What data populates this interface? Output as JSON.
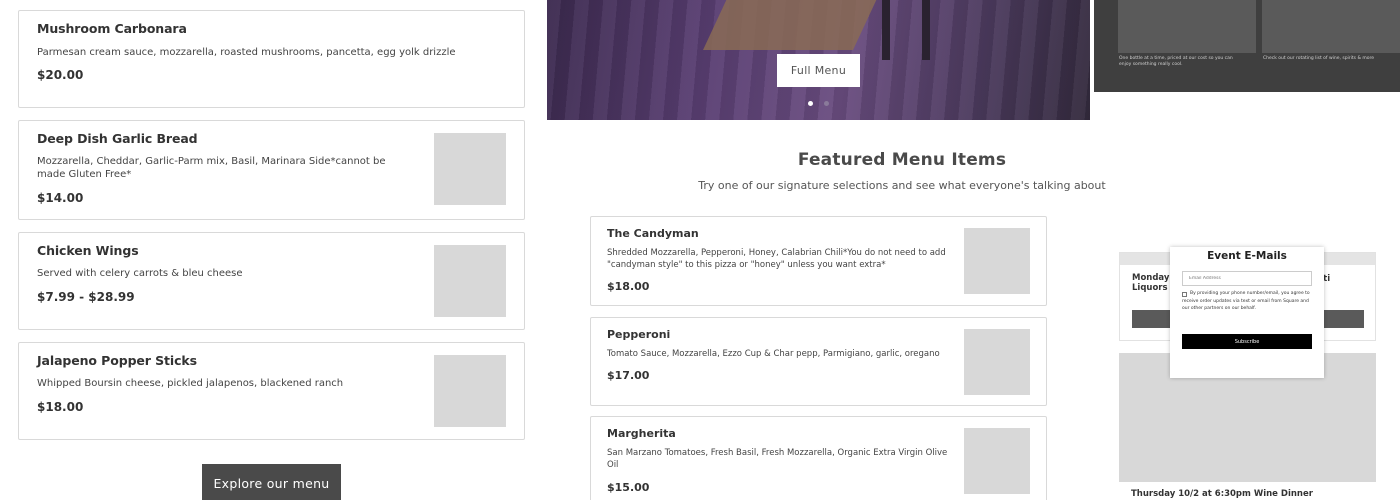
{
  "menu_items": [
    {
      "name": "Mushroom Carbonara",
      "desc": "Parmesan cream sauce, mozzarella, roasted mushrooms, pancetta, egg yolk drizzle",
      "price": "$20.00"
    },
    {
      "name": "Deep Dish Garlic Bread",
      "desc": "Mozzarella, Cheddar, Garlic-Parm mix, Basil, Marinara Side*cannot be made Gluten Free*",
      "price": "$14.00"
    },
    {
      "name": "Chicken Wings",
      "desc": "Served with celery carrots & bleu cheese",
      "price": "$7.99 - $28.99"
    },
    {
      "name": "Jalapeno Popper Sticks",
      "desc": "Whipped Boursin cheese, pickled jalapenos, blackened ranch",
      "price": "$18.00"
    }
  ],
  "explore_button": "Explore our menu",
  "hero": {
    "full_menu_button": "Full Menu",
    "dot_active_color": "#ffffff",
    "dot_inactive_color": "#8a7a9a"
  },
  "featured": {
    "title": "Featured Menu Items",
    "subtitle": "Try one of our signature selections and see what everyone's talking about",
    "items": [
      {
        "name": "The Candyman",
        "desc": "Shredded Mozzarella, Pepperoni, Honey, Calabrian Chili*You do not need to add \"candyman style\" to this pizza or \"honey\" unless you want extra*",
        "price": "$18.00"
      },
      {
        "name": "Pepperoni",
        "desc": "Tomato Sauce, Mozzarella, Ezzo Cup & Char pepp, Parmigiano, garlic, oregano",
        "price": "$17.00"
      },
      {
        "name": "Margherita",
        "desc": "San Marzano Tomatoes, Fresh Basil, Fresh Mozzarella, Organic Extra Virgin Olive Oil",
        "price": "$15.00"
      }
    ]
  },
  "promo_tiles": [
    {
      "text": "One bottle at a time, priced at our cost so you can enjoy something really cool."
    },
    {
      "text": "Check out our rotating list of wine, spirits & more"
    }
  ],
  "event_card": {
    "title_left": "Monday 1",
    "title_left_line2": "Liquors",
    "title_right": "puti"
  },
  "popup": {
    "title": "Event E-Mails",
    "email_placeholder": "Email Address",
    "consent": "By providing your phone number/email, you agree to receive order updates via text or email from Square and our other partners on our behalf.",
    "subscribe": "Subscribe"
  },
  "thursday_event": "Thursday 10/2 at 6:30pm Wine Dinner"
}
